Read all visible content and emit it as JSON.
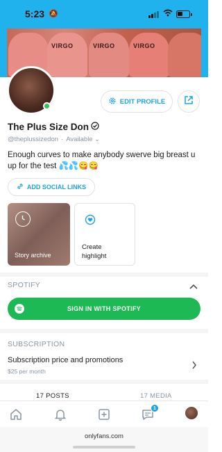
{
  "status_bar": {
    "time": "5:23",
    "battery_level": 0.45
  },
  "profile": {
    "name": "The Plus Size Don",
    "handle": "@theplussizedon",
    "availability": "Available",
    "bio": "Enough curves to make anybody swerve big breast u up for the test 💦💦😋😋",
    "cover_text": "VIRGO"
  },
  "actions": {
    "edit_profile": "EDIT PROFILE",
    "add_social_links": "ADD SOCIAL LINKS"
  },
  "highlights": {
    "story_archive": "Story archive",
    "create_highlight_line1": "Create",
    "create_highlight_line2": "highlight"
  },
  "spotify": {
    "section_title": "SPOTIFY",
    "sign_in": "SIGN IN WITH SPOTIFY"
  },
  "subscription": {
    "section_title": "SUBSCRIPTION",
    "price_label": "Subscription price and promotions",
    "price_sub": "$25 per month"
  },
  "tabs": [
    {
      "label": "17 POSTS"
    },
    {
      "label": "17 MEDIA"
    }
  ],
  "nav": {
    "messages_badge": "1"
  },
  "browser": {
    "url": "onlyfans.com"
  },
  "colors": {
    "accent": "#1fa3e0",
    "spotify": "#1db954",
    "header": "#1fb2ec"
  }
}
